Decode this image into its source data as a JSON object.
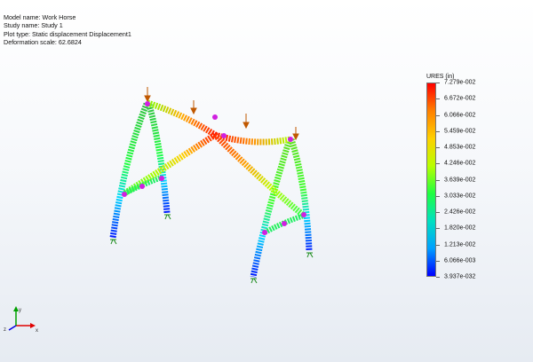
{
  "info": {
    "model_name": "Model name: Work Horse",
    "study_name": "Study name: Study 1",
    "plot_type": "Plot type: Static displacement Displacement1",
    "deformation_scale": "Deformation scale: 62.6824"
  },
  "legend": {
    "title": "URES (in)",
    "labels": [
      "7.279e-002",
      "6.672e-002",
      "6.066e-002",
      "5.459e-002",
      "4.853e-002",
      "4.246e-002",
      "3.639e-002",
      "3.033e-002",
      "2.426e-002",
      "1.820e-002",
      "1.213e-002",
      "6.066e-003",
      "3.937e-032"
    ],
    "colors": [
      "#ff0000",
      "#ff8000",
      "#ffd000",
      "#b8ff00",
      "#20ff40",
      "#00e0c0",
      "#00a0ff",
      "#0000ff"
    ]
  },
  "triad": {
    "x": "x",
    "y": "y",
    "z": "z"
  },
  "icons": [
    "load-arrow-icon",
    "fixture-icon",
    "triad-icon",
    "connector-sphere-icon"
  ]
}
